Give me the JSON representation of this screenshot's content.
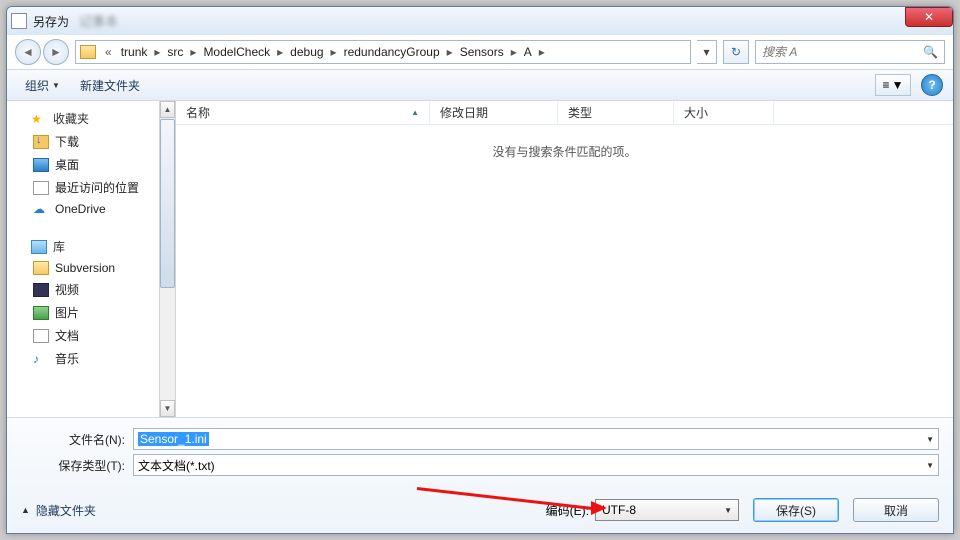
{
  "title": "另存为",
  "breadcrumb": [
    "trunk",
    "src",
    "ModelCheck",
    "debug",
    "redundancyGroup",
    "Sensors",
    "A"
  ],
  "search_placeholder": "搜索 A",
  "toolbar": {
    "organize": "组织",
    "newfolder": "新建文件夹"
  },
  "sidebar": {
    "fav": "收藏夹",
    "downloads": "下载",
    "desktop": "桌面",
    "recent": "最近访问的位置",
    "onedrive": "OneDrive",
    "library": "库",
    "subversion": "Subversion",
    "video": "视频",
    "pictures": "图片",
    "docs": "文档",
    "music": "音乐"
  },
  "columns": {
    "name": "名称",
    "date": "修改日期",
    "type": "类型",
    "size": "大小"
  },
  "empty_msg": "没有与搜索条件匹配的项。",
  "fields": {
    "filename_label": "文件名(N):",
    "filename_value": "Sensor_1.ini",
    "savetype_label": "保存类型(T):",
    "savetype_value": "文本文档(*.txt)",
    "encoding_label": "编码(E):",
    "encoding_value": "UTF-8"
  },
  "buttons": {
    "hide": "隐藏文件夹",
    "save": "保存(S)",
    "cancel": "取消"
  }
}
